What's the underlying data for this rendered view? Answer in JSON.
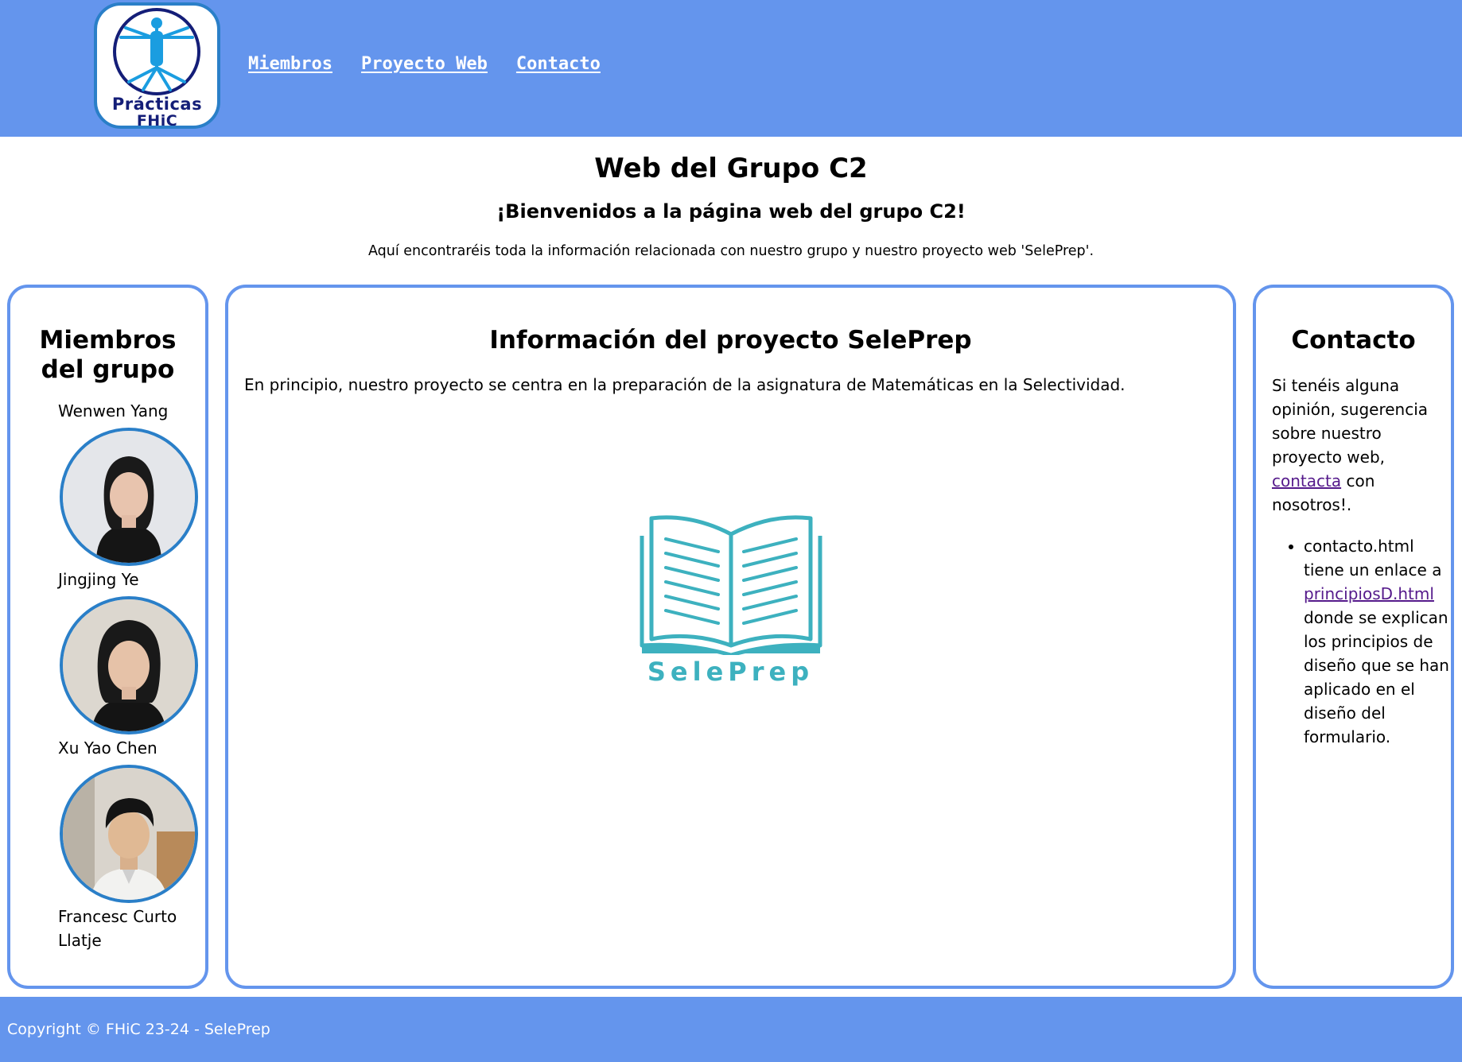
{
  "header": {
    "logo": {
      "line1": "Prácticas",
      "line2": "FHiC"
    },
    "nav": [
      {
        "label": "Miembros"
      },
      {
        "label": "Proyecto Web"
      },
      {
        "label": "Contacto"
      }
    ]
  },
  "intro": {
    "title": "Web del Grupo C2",
    "subtitle": "¡Bienvenidos a la página web del grupo C2!",
    "text": "Aquí encontraréis toda la información relacionada con nuestro grupo y nuestro proyecto web 'SelePrep'."
  },
  "members": {
    "title_line1": "Miembros",
    "title_line2": "del grupo",
    "list": [
      {
        "name": "Wenwen Yang"
      },
      {
        "name": "Jingjing Ye"
      },
      {
        "name": "Xu Yao Chen"
      },
      {
        "name_line1": "Francesc Curto",
        "name_line2": "Llatje"
      }
    ]
  },
  "project": {
    "title": "Información del proyecto SelePrep",
    "text": "En principio, nuestro proyecto se centra en la preparación de la asignatura de Matemáticas en la Selectividad.",
    "logo_label": "SelePrep"
  },
  "contact": {
    "title": "Contacto",
    "text_before": "Si tenéis alguna opinión, sugerencia sobre nuestro proyecto web, ",
    "link_label": "contacta",
    "text_after": " con nosotros!.",
    "item_before": "contacto.html tiene un enlace a ",
    "item_link": "principiosD.html",
    "item_after": " donde se explican los principios de diseño que se han aplicado en el diseño del formulario."
  },
  "footer": {
    "text": "Copyright © FHiC 23-24 - SelePrep"
  },
  "colors": {
    "accent": "#6495ed",
    "border_blue": "#2a7fc8",
    "teal": "#3db1bf",
    "link_visited": "#551a8b"
  }
}
